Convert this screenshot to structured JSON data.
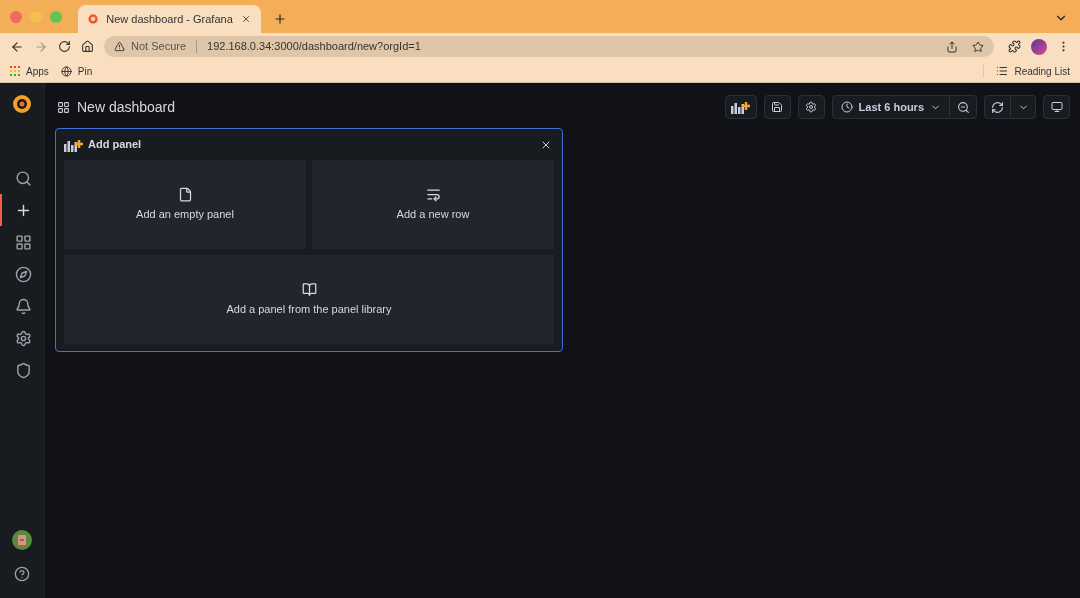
{
  "browser": {
    "tab": {
      "title": "New dashboard - Grafana"
    },
    "address": {
      "security": "Not Secure",
      "url": "192.168.0.34:3000/dashboard/new?orgId=1"
    },
    "bookmarks": [
      "Apps",
      "Pin"
    ],
    "reading_list": "Reading List"
  },
  "sidebar": {
    "items": [
      {
        "kind": "search",
        "selected": false
      },
      {
        "kind": "create",
        "selected": true
      },
      {
        "kind": "dashboards",
        "selected": false
      },
      {
        "kind": "explore",
        "selected": false
      },
      {
        "kind": "alerting",
        "selected": false
      },
      {
        "kind": "configuration",
        "selected": false
      },
      {
        "kind": "admin",
        "selected": false
      }
    ]
  },
  "header": {
    "title": "New dashboard",
    "time_range": "Last 6 hours"
  },
  "add_panel": {
    "title": "Add panel",
    "options": [
      {
        "kind": "empty",
        "label": "Add an empty panel"
      },
      {
        "kind": "row",
        "label": "Add a new row"
      },
      {
        "kind": "library",
        "label": "Add a panel from the panel library"
      }
    ]
  }
}
